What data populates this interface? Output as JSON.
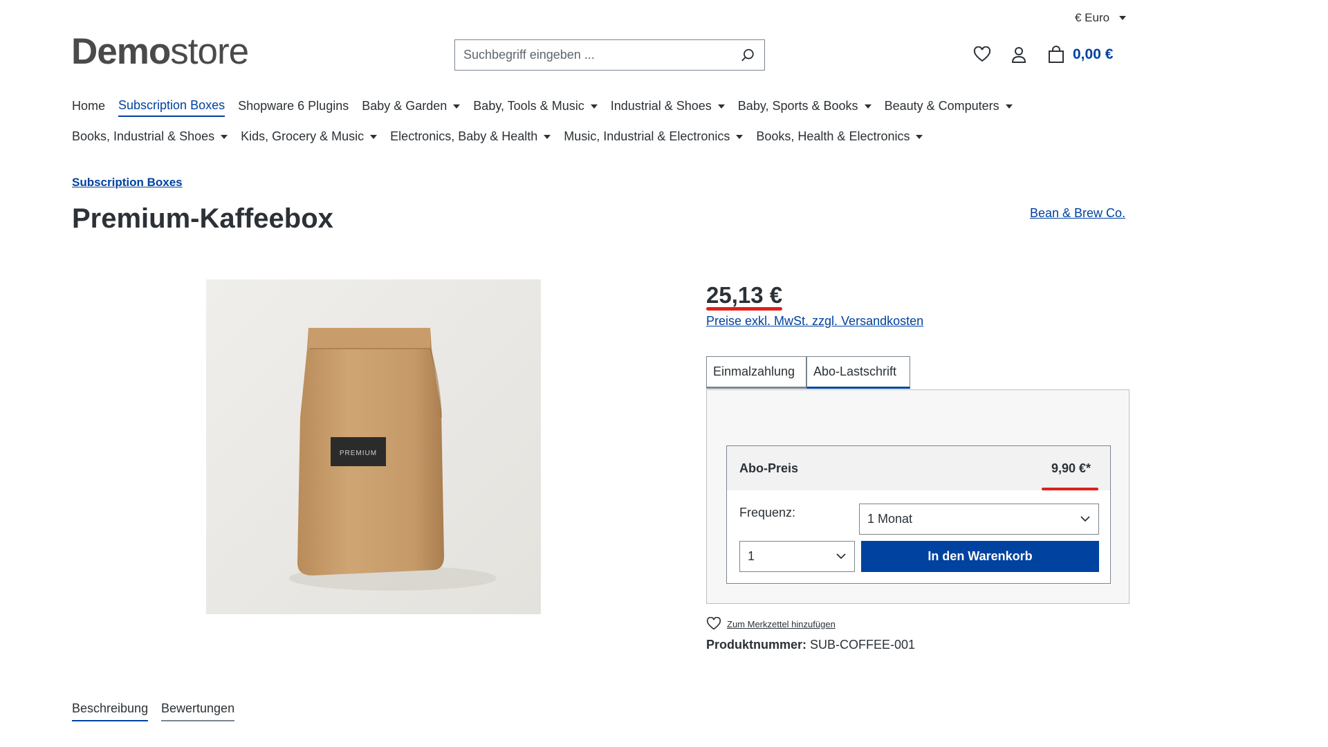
{
  "header": {
    "currency": "€ Euro",
    "logo_bold": "Demo",
    "logo_light": "store",
    "search_placeholder": "Suchbegriff eingeben ...",
    "cart_total": "0,00 €"
  },
  "nav": {
    "row1": [
      {
        "label": "Home",
        "dropdown": false,
        "active": false
      },
      {
        "label": "Subscription Boxes",
        "dropdown": false,
        "active": true
      },
      {
        "label": "Shopware 6 Plugins",
        "dropdown": false,
        "active": false
      },
      {
        "label": "Baby & Garden",
        "dropdown": true,
        "active": false
      },
      {
        "label": "Baby, Tools & Music",
        "dropdown": true,
        "active": false
      },
      {
        "label": "Industrial & Shoes",
        "dropdown": true,
        "active": false
      },
      {
        "label": "Baby, Sports & Books",
        "dropdown": true,
        "active": false
      },
      {
        "label": "Beauty & Computers",
        "dropdown": true,
        "active": false
      }
    ],
    "row2": [
      {
        "label": "Books, Industrial & Shoes",
        "dropdown": true,
        "active": false
      },
      {
        "label": "Kids, Grocery & Music",
        "dropdown": true,
        "active": false
      },
      {
        "label": "Electronics, Baby & Health",
        "dropdown": true,
        "active": false
      },
      {
        "label": "Music, Industrial & Electronics",
        "dropdown": true,
        "active": false
      },
      {
        "label": "Books, Health & Electronics",
        "dropdown": true,
        "active": false
      }
    ]
  },
  "product": {
    "breadcrumb": "Subscription Boxes",
    "title": "Premium-Kaffeebox",
    "manufacturer": "Bean & Brew Co.",
    "image_label": "PREMIUM",
    "price": "25,13 €",
    "tax_note": "Preise exkl. MwSt. zzgl. Versandkosten",
    "tabs": [
      "Einmalzahlung",
      "Abo-Lastschrift"
    ],
    "active_tab": "Abo-Lastschrift",
    "subscription": {
      "price_label": "Abo-Preis",
      "price": "9,90 €*",
      "frequency_label": "Frequenz:",
      "frequency_value": "1 Monat",
      "quantity_value": "1",
      "add_to_cart": "In den Warenkorb"
    },
    "wishlist_label": "Zum Merkzettel hinzufügen",
    "product_number_label": "Produktnummer:",
    "product_number": "SUB-COFFEE-001"
  },
  "detail_tabs": [
    "Beschreibung",
    "Bewertungen"
  ],
  "colors": {
    "primary": "#0042a0",
    "text": "#2b3136",
    "highlight": "#e0201b"
  }
}
